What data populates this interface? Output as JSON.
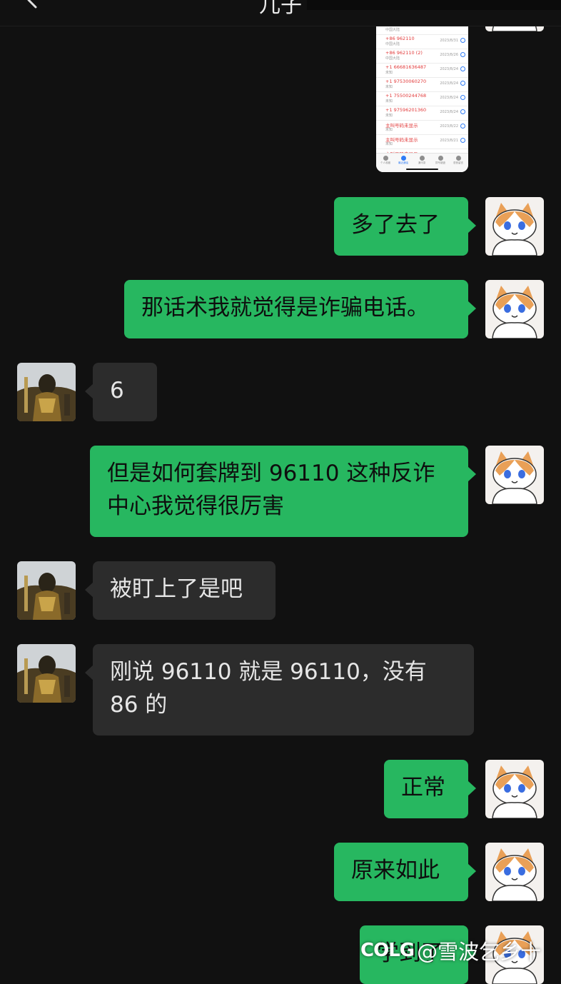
{
  "header": {
    "title": "儿子"
  },
  "screenshot": {
    "calls": [
      {
        "number": "",
        "location": "中国大陆",
        "date": ""
      },
      {
        "number": "+86 962110",
        "location": "中国大陆",
        "date": "2023/8/31"
      },
      {
        "number": "+86 962110 (2)",
        "location": "中国大陆",
        "date": "2023/8/26"
      },
      {
        "number": "+1 66681636487",
        "location": "未知",
        "date": "2023/8/24"
      },
      {
        "number": "+1 97530060270",
        "location": "未知",
        "date": "2023/8/24"
      },
      {
        "number": "+1 75500244768",
        "location": "未知",
        "date": "2023/8/24"
      },
      {
        "number": "+1 97596201360",
        "location": "未知",
        "date": "2023/8/24"
      },
      {
        "number": "主叫号码未显示",
        "location": "未知",
        "date": "2023/8/22"
      },
      {
        "number": "主叫号码未显示",
        "location": "未知",
        "date": "2023/8/21"
      },
      {
        "number": "主叫号码未显示",
        "location": "",
        "date": ""
      }
    ],
    "tabs": [
      "个人收藏",
      "最近通话",
      "通讯录",
      "拨号键盘",
      "语音留言"
    ]
  },
  "messages": [
    {
      "from": "me",
      "text": "多了去了"
    },
    {
      "from": "me",
      "text": "那话术我就觉得是诈骗电话。"
    },
    {
      "from": "other",
      "text": "6"
    },
    {
      "from": "me",
      "text": "但是如何套牌到 96110 这种反诈中心我觉得很厉害"
    },
    {
      "from": "other",
      "text": "被盯上了是吧"
    },
    {
      "from": "other",
      "text": "刚说 96110 就是 96110，没有 86 的"
    },
    {
      "from": "me",
      "text": "正常"
    },
    {
      "from": "me",
      "text": "原来如此"
    },
    {
      "from": "me",
      "text": "学到了"
    }
  ],
  "watermark": {
    "logo": "COLG",
    "text": "@雪波乞乡十"
  },
  "colors": {
    "background": "#111111",
    "my_bubble": "#27b760",
    "their_bubble": "#2c2c2c",
    "missed_call": "#e23a3a"
  }
}
